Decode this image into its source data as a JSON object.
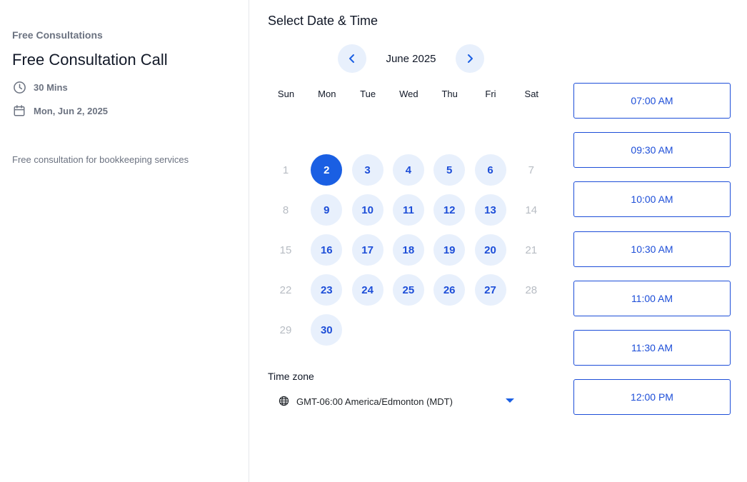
{
  "event": {
    "organization": "Free Consultations",
    "title": "Free Consultation Call",
    "duration": "30 Mins",
    "date": "Mon, Jun 2, 2025",
    "description": "Free consultation for bookkeeping services",
    "icons": {
      "duration": "clock-icon",
      "date": "calendar-icon"
    }
  },
  "picker": {
    "heading": "Select Date & Time",
    "month_label": "June 2025",
    "prev_icon": "chevron-left-icon",
    "next_icon": "chevron-right-icon",
    "weekdays": [
      "Sun",
      "Mon",
      "Tue",
      "Wed",
      "Thu",
      "Fri",
      "Sat"
    ],
    "weeks": [
      [
        {
          "day": "1",
          "state": "disabled"
        },
        {
          "day": "2",
          "state": "selected"
        },
        {
          "day": "3",
          "state": "available"
        },
        {
          "day": "4",
          "state": "available"
        },
        {
          "day": "5",
          "state": "available"
        },
        {
          "day": "6",
          "state": "available"
        },
        {
          "day": "7",
          "state": "disabled"
        }
      ],
      [
        {
          "day": "8",
          "state": "disabled"
        },
        {
          "day": "9",
          "state": "available"
        },
        {
          "day": "10",
          "state": "available"
        },
        {
          "day": "11",
          "state": "available"
        },
        {
          "day": "12",
          "state": "available"
        },
        {
          "day": "13",
          "state": "available"
        },
        {
          "day": "14",
          "state": "disabled"
        }
      ],
      [
        {
          "day": "15",
          "state": "disabled"
        },
        {
          "day": "16",
          "state": "available"
        },
        {
          "day": "17",
          "state": "available"
        },
        {
          "day": "18",
          "state": "available"
        },
        {
          "day": "19",
          "state": "available"
        },
        {
          "day": "20",
          "state": "available"
        },
        {
          "day": "21",
          "state": "disabled"
        }
      ],
      [
        {
          "day": "22",
          "state": "disabled"
        },
        {
          "day": "23",
          "state": "available"
        },
        {
          "day": "24",
          "state": "available"
        },
        {
          "day": "25",
          "state": "available"
        },
        {
          "day": "26",
          "state": "available"
        },
        {
          "day": "27",
          "state": "available"
        },
        {
          "day": "28",
          "state": "disabled"
        }
      ],
      [
        {
          "day": "29",
          "state": "disabled"
        },
        {
          "day": "30",
          "state": "available"
        }
      ]
    ]
  },
  "timezone": {
    "label": "Time zone",
    "value": "GMT-06:00 America/Edmonton (MDT)",
    "icon": "globe-icon"
  },
  "time_slots": [
    "07:00 AM",
    "09:30 AM",
    "10:00 AM",
    "10:30 AM",
    "11:00 AM",
    "11:30 AM",
    "12:00 PM"
  ],
  "colors": {
    "accent": "#1a5fe3",
    "available_bg": "#e8f0fc",
    "available_text": "#1d4ed8",
    "disabled_text": "#b7bcc3"
  }
}
